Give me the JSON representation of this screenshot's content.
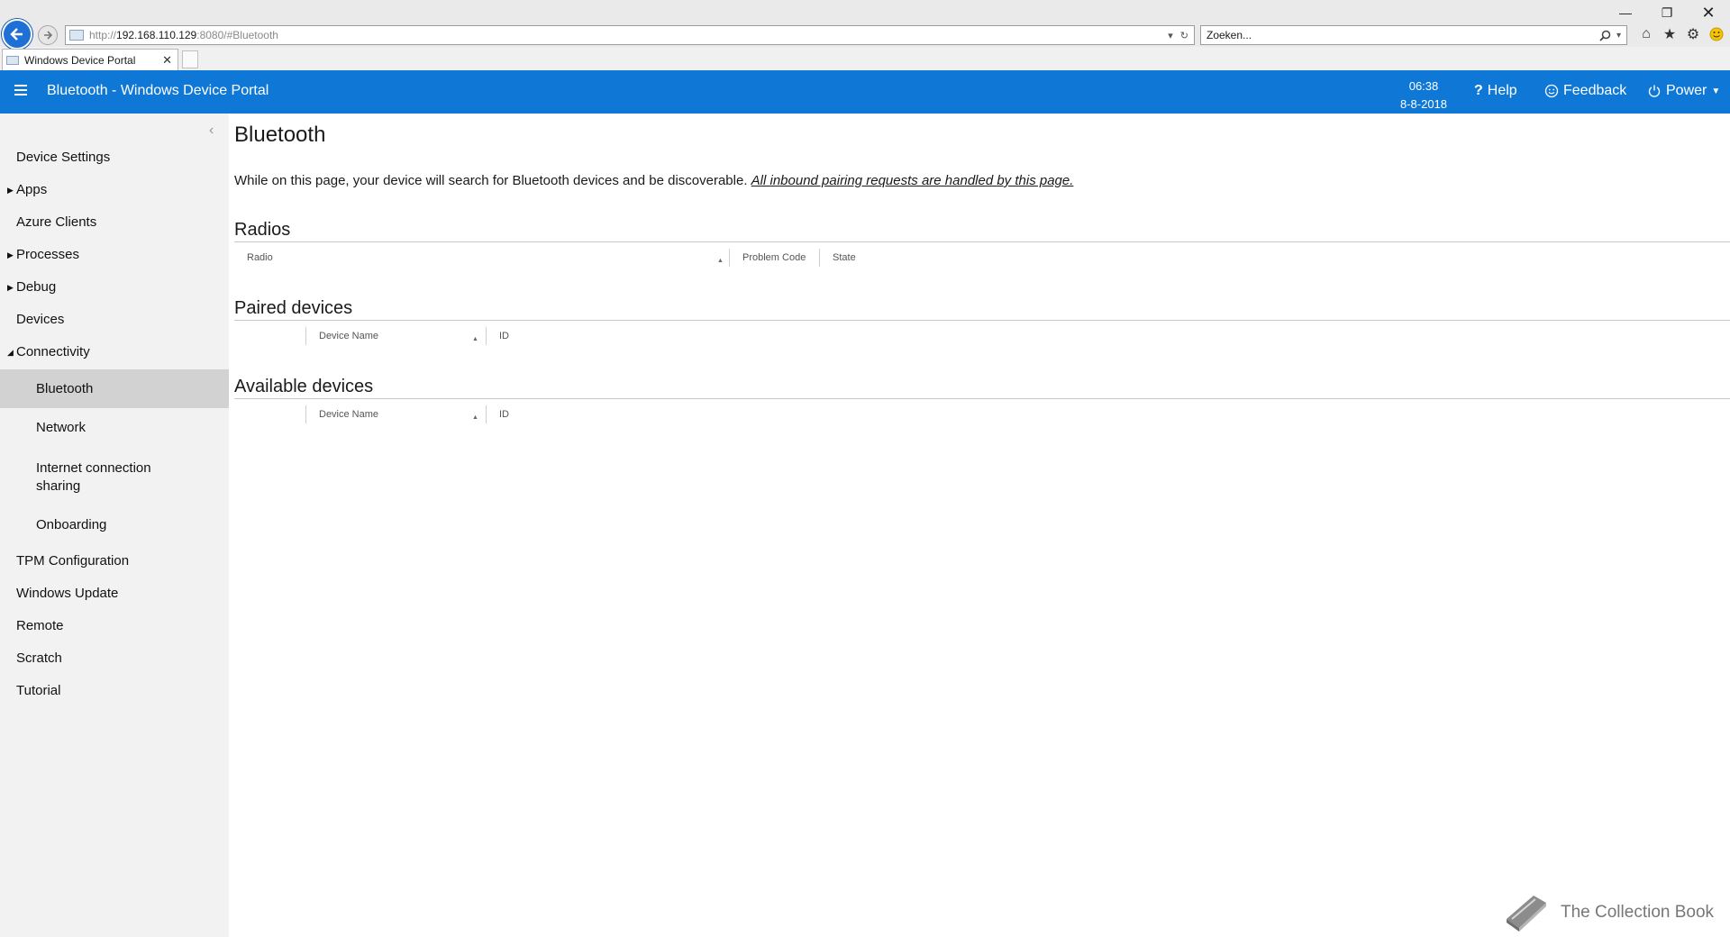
{
  "browser": {
    "url_scheme": "http://",
    "url_host": "192.168.110.129",
    "url_rest": ":8080/#Bluetooth",
    "search_placeholder": "Zoeken...",
    "tab_title": "Windows Device Portal",
    "icons": [
      "back-icon",
      "forward-icon",
      "refresh-icon",
      "dropdown-icon",
      "search-icon",
      "home-icon",
      "favorites-star-icon",
      "settings-gear-icon",
      "smiley-icon",
      "minimize-icon",
      "restore-icon",
      "close-icon"
    ]
  },
  "header": {
    "title": "Bluetooth - Windows Device Portal",
    "time": "06:38",
    "date": "8-8-2018",
    "help": "Help",
    "feedback": "Feedback",
    "power": "Power",
    "color": "#0f78d7"
  },
  "sidebar": {
    "items": [
      {
        "label": "Device Settings"
      },
      {
        "label": "Apps"
      },
      {
        "label": "Azure Clients"
      },
      {
        "label": "Processes"
      },
      {
        "label": "Debug"
      },
      {
        "label": "Devices"
      },
      {
        "label": "Connectivity"
      },
      {
        "label": "Bluetooth"
      },
      {
        "label": "Network"
      },
      {
        "label": "Internet connection sharing"
      },
      {
        "label": "Onboarding"
      },
      {
        "label": "TPM Configuration"
      },
      {
        "label": "Windows Update"
      },
      {
        "label": "Remote"
      },
      {
        "label": "Scratch"
      },
      {
        "label": "Tutorial"
      }
    ]
  },
  "main": {
    "title": "Bluetooth",
    "intro": "While on this page, your device will search for Bluetooth devices and be discoverable. ",
    "intro_link": "All inbound pairing requests are handled by this page.",
    "radios": {
      "title": "Radios",
      "columns": [
        "Radio",
        "Problem Code",
        "State"
      ]
    },
    "paired": {
      "title": "Paired devices",
      "columns": [
        "Device Name",
        "ID"
      ]
    },
    "available": {
      "title": "Available devices",
      "columns": [
        "Device Name",
        "ID"
      ]
    }
  },
  "watermark": "The Collection Book"
}
